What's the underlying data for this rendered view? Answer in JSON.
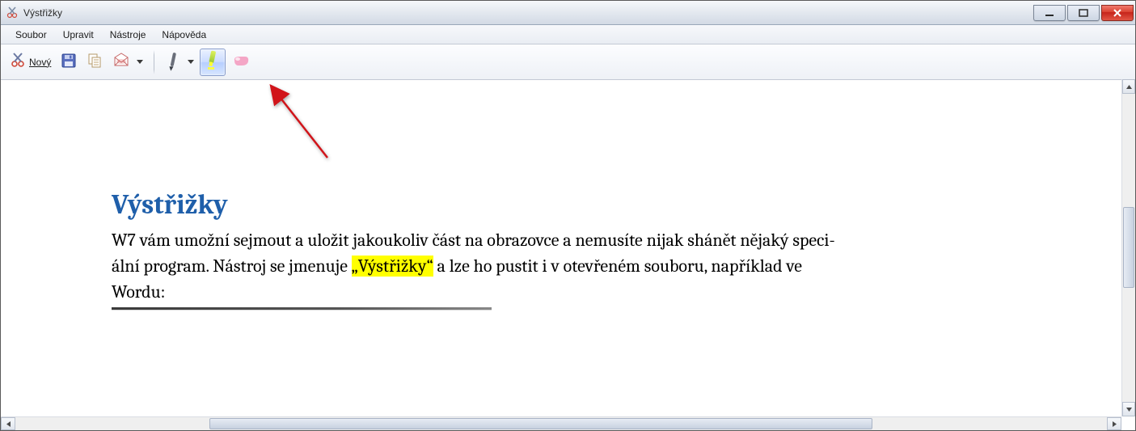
{
  "window": {
    "title": "Výstřižky"
  },
  "menubar": {
    "items": [
      "Soubor",
      "Upravit",
      "Nástroje",
      "Nápověda"
    ]
  },
  "toolbar": {
    "new_label": "Nový"
  },
  "document": {
    "heading": "Výstřižky",
    "line1_a": "W7 vám umožní sejmout a uložit jakoukoliv část na obrazovce a nemusíte nijak shánět nějaký speci-",
    "line2_a": "ální program. Nástroj se jmenuje ",
    "line2_hl": "„Výstřižky“",
    "line2_b": " a lze ho pustit i v otevřeném souboru, například ve",
    "line3": "Wordu:"
  }
}
